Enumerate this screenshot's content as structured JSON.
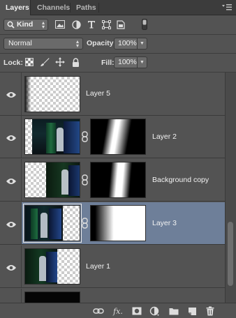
{
  "tabs": [
    {
      "label": "Layers",
      "active": true
    },
    {
      "label": "Channels",
      "active": false
    },
    {
      "label": "Paths",
      "active": false
    }
  ],
  "filter": {
    "kind_label": "Kind"
  },
  "blend": {
    "mode": "Normal",
    "opacity_label": "Opacity:",
    "opacity_value": "100%"
  },
  "lock": {
    "label": "Lock:",
    "fill_label": "Fill:",
    "fill_value": "100%"
  },
  "layers": [
    {
      "name": "Layer 5",
      "visible": true,
      "selected": false,
      "has_mask": false
    },
    {
      "name": "Layer 2",
      "visible": true,
      "selected": false,
      "has_mask": true
    },
    {
      "name": "Background copy",
      "visible": true,
      "selected": false,
      "has_mask": true
    },
    {
      "name": "Layer 3",
      "visible": true,
      "selected": true,
      "has_mask": true
    },
    {
      "name": "Layer 1",
      "visible": true,
      "selected": false,
      "has_mask": false
    }
  ],
  "icons": {
    "filters": [
      "image-filter-icon",
      "adjustment-filter-icon",
      "type-filter-icon",
      "shape-filter-icon",
      "smart-object-filter-icon",
      "filter-toggle-icon"
    ],
    "locks": [
      "lock-transparent-pixels-icon",
      "lock-image-pixels-icon",
      "lock-position-icon",
      "lock-all-icon"
    ],
    "bottom": [
      "link-layers-icon",
      "layer-style-fx-icon",
      "add-mask-icon",
      "adjustment-layer-icon",
      "new-group-icon",
      "new-layer-icon",
      "delete-layer-icon"
    ]
  },
  "bottom_fx_label": "fx.",
  "colors": {
    "panel": "#535353",
    "selection": "#6e7f99",
    "tabbar": "#3c3c3c"
  }
}
